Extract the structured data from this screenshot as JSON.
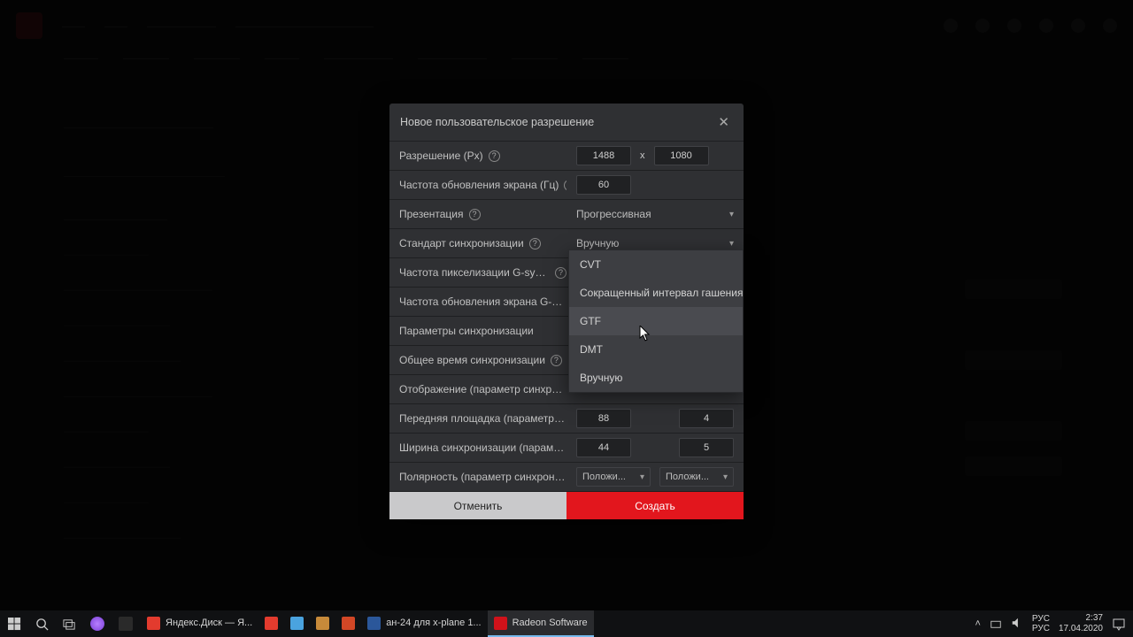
{
  "modal": {
    "title": "Новое пользовательское разрешение",
    "rows": {
      "resolution": {
        "label": "Разрешение (Px)",
        "w": "1488",
        "h": "1080",
        "times": "x"
      },
      "refresh": {
        "label": "Частота обновления экрана (Гц)",
        "value": "60"
      },
      "presentation": {
        "label": "Презентация",
        "value": "Прогрессивная"
      },
      "timing_std": {
        "label": "Стандарт синхронизации",
        "value": "Вручную"
      },
      "gsync_pixclk": {
        "label": "Частота пикселизации G-sync (кГц)"
      },
      "gsync_refresh": {
        "label": "Частота обновления экрана G-Sync (Гц)"
      },
      "timing_params": {
        "label": "Параметры синхронизации"
      },
      "timing_total": {
        "label": "Общее время синхронизации"
      },
      "timing_display": {
        "label": "Отображение (параметр синхронизации)"
      },
      "front_porch": {
        "label": "Передняя площадка (параметр синхрон",
        "h": "88",
        "v": "4"
      },
      "sync_width": {
        "label": "Ширина синхронизации (параметр синх",
        "h": "44",
        "v": "5"
      },
      "polarity": {
        "label": "Полярность (параметр синхронизации)",
        "h": "Положи...",
        "v": "Положи..."
      }
    },
    "std_options": [
      "CVT",
      "Сокращенный интервал гашения (...",
      "GTF",
      "DMT",
      "Вручную"
    ],
    "buttons": {
      "cancel": "Отменить",
      "create": "Создать"
    }
  },
  "taskbar": {
    "tasks": [
      {
        "label": "Яндекс.Диск — Я...",
        "color": "#e33b2e"
      },
      {
        "label": "",
        "color": "#e33b2e"
      },
      {
        "label": "",
        "color": "#4aa3df"
      },
      {
        "label": "",
        "color": "#c78a3a"
      },
      {
        "label": "",
        "color": "#d24726"
      },
      {
        "label": "ан-24 для x-plane 1...",
        "color": "#2b579a"
      },
      {
        "label": "Radeon Software",
        "color": "#d0121a",
        "active": true
      }
    ],
    "lang1": "РУС",
    "lang2": "РУС",
    "time": "2:37",
    "date": "17.04.2020"
  }
}
